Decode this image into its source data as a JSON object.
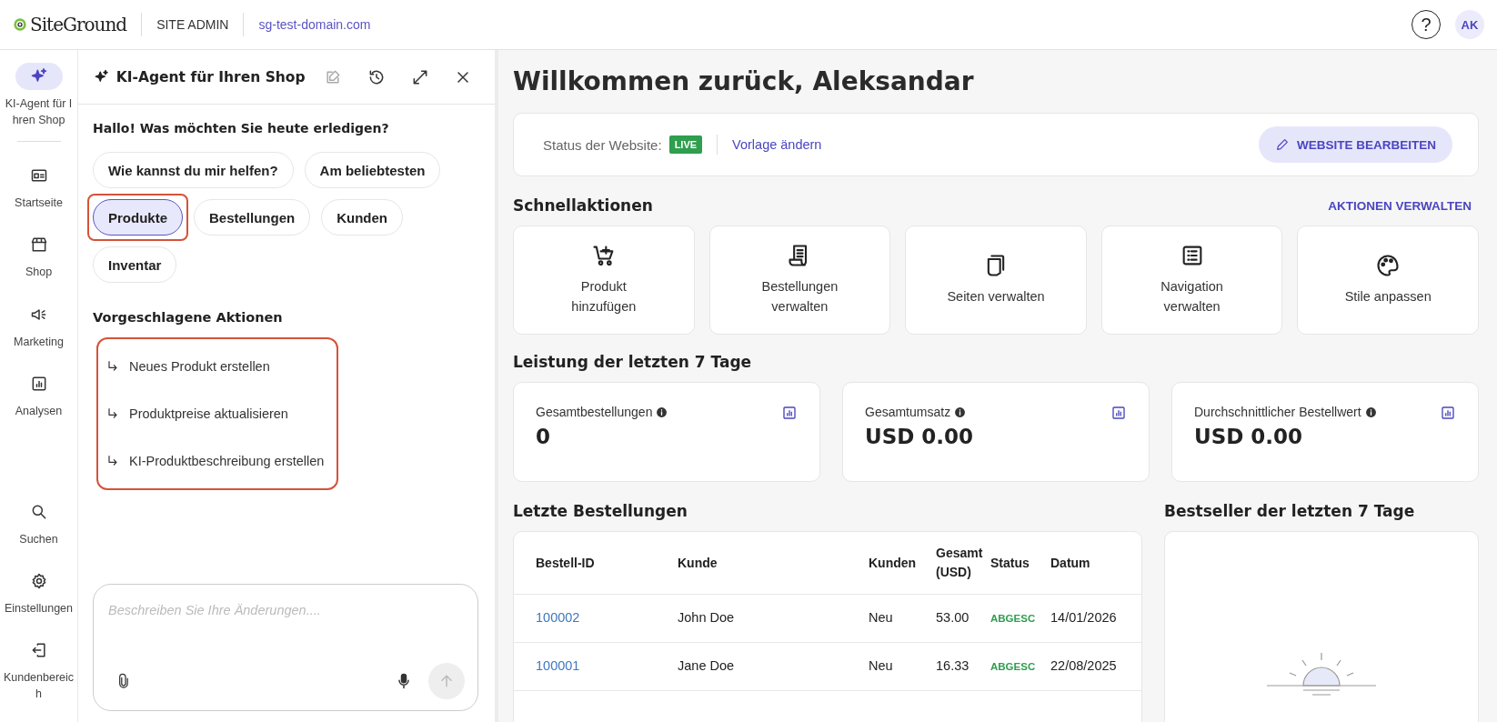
{
  "topbar": {
    "logo": "SiteGround",
    "section": "SITE ADMIN",
    "domain": "sg-test-domain.com",
    "help": "?",
    "avatar": "AK"
  },
  "rail": {
    "items": [
      {
        "kind": "sparkle",
        "label": "KI-Agent für Ihren Shop",
        "selected": true
      },
      {
        "kind": "home",
        "label": "Startseite",
        "selected": false
      },
      {
        "kind": "shop",
        "label": "Shop",
        "selected": false
      },
      {
        "kind": "marketing",
        "label": "Marketing",
        "selected": false
      },
      {
        "kind": "analytics",
        "label": "Analysen",
        "selected": false
      }
    ],
    "bottom_items": [
      {
        "kind": "search",
        "label": "Suchen",
        "selected": false
      },
      {
        "kind": "settings",
        "label": "Einstellungen",
        "selected": false
      },
      {
        "kind": "exit",
        "label": "Kundenbereich",
        "selected": false
      }
    ]
  },
  "chat": {
    "title": "KI-Agent für Ihren Shop",
    "greeting": "Hallo! Was möchten Sie heute erledigen?",
    "chips": [
      {
        "label": "Wie kannst du mir helfen?",
        "selected": false,
        "highlighted": false
      },
      {
        "label": "Am beliebtesten",
        "selected": false,
        "highlighted": false
      },
      {
        "label": "Produkte",
        "selected": true,
        "highlighted": true
      },
      {
        "label": "Bestellungen",
        "selected": false,
        "highlighted": false
      },
      {
        "label": "Kunden",
        "selected": false,
        "highlighted": false
      },
      {
        "label": "Inventar",
        "selected": false,
        "highlighted": false
      }
    ],
    "actions_title": "Vorgeschlagene Aktionen",
    "actions_highlighted": true,
    "actions": [
      "Neues Produkt erstellen",
      "Produktpreise aktualisieren",
      "KI-Produktbeschreibung erstellen"
    ],
    "input": {
      "placeholder": "Beschreiben Sie Ihre Änderungen...."
    }
  },
  "main": {
    "title": "Willkommen zurück, Aleksandar",
    "status": {
      "label": "Status der Website:",
      "badge": "LIVE",
      "link": "Vorlage ändern",
      "button": "WEBSITE BEARBEITEN"
    },
    "quick_title": "Schnellaktionen",
    "quick_manage": "AKTIONEN VERWALTEN",
    "quick_actions": [
      {
        "kind": "cart",
        "label": "Produkt hinzufügen"
      },
      {
        "kind": "receipt",
        "label": "Bestellungen verwalten"
      },
      {
        "kind": "pages",
        "label": "Seiten verwalten"
      },
      {
        "kind": "list",
        "label": "Navigation verwalten"
      },
      {
        "kind": "palette",
        "label": "Stile anpassen"
      }
    ],
    "performance_title": "Leistung der letzten 7 Tage",
    "stats": [
      {
        "label": "Gesamtbestellungen",
        "value": "0"
      },
      {
        "label": "Gesamtumsatz",
        "value": "USD 0.00"
      },
      {
        "label": "Durchschnittlicher Bestellwert",
        "value": "USD 0.00"
      }
    ],
    "orders_title": "Letzte Bestellungen",
    "table": {
      "columns": [
        "Bestell-ID",
        "Kunde",
        "Kunden",
        "Gesamt (USD)",
        "Status",
        "Datum"
      ],
      "rows": [
        [
          "100002",
          "John Doe",
          "Neu",
          "53.00",
          "ABGESC",
          "14/01/2026"
        ],
        [
          "100001",
          "Jane Doe",
          "Neu",
          "16.33",
          "ABGESC",
          "22/08/2025"
        ]
      ]
    },
    "bestseller_title": "Bestseller der letzten 7 Tage"
  }
}
